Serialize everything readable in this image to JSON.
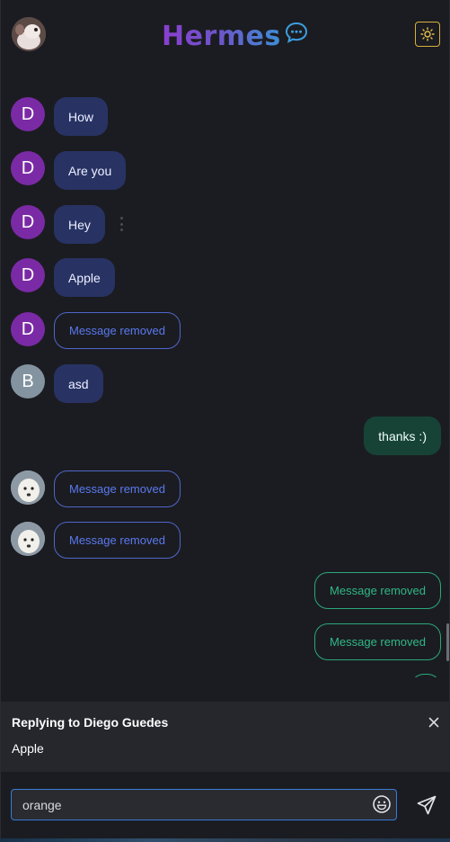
{
  "header": {
    "brand": "Hermes",
    "brand_icon": "chat-bubble-icon",
    "theme_icon": "sun-icon",
    "colors": {
      "brand_start": "#8a3ecf",
      "brand_end": "#3d8fd6",
      "theme_border": "#d8b03c"
    }
  },
  "messages": [
    {
      "side": "in",
      "avatar": "D",
      "text": "How"
    },
    {
      "side": "in",
      "avatar": "D",
      "text": "Are you"
    },
    {
      "side": "in",
      "avatar": "D",
      "text": "Hey"
    },
    {
      "side": "in",
      "avatar": "D",
      "text": "Apple"
    },
    {
      "side": "in",
      "avatar": "D",
      "text": "Message removed",
      "removed": true
    },
    {
      "side": "in",
      "avatar": "B",
      "text": "asd"
    },
    {
      "side": "out",
      "text": "thanks :)"
    },
    {
      "side": "in",
      "avatar": "dog-photo",
      "text": "Message removed",
      "removed": true
    },
    {
      "side": "in",
      "avatar": "dog-photo",
      "text": "Message removed",
      "removed": true
    },
    {
      "side": "out",
      "text": "Message removed",
      "removed": true
    },
    {
      "side": "out",
      "text": "Message removed",
      "removed": true
    }
  ],
  "reply": {
    "title": "Replying to Diego Guedes",
    "text": "Apple",
    "close_icon": "close-icon"
  },
  "composer": {
    "value": "orange",
    "emoji_icon": "emoji-icon",
    "send_icon": "send-icon"
  },
  "colors": {
    "background": "#1b1c21",
    "incoming_bubble": "#283364",
    "outgoing_bubble": "#174337",
    "removed_in": "#5a79ee",
    "removed_out": "#2fb885",
    "avatar_d": "#7b2aa5",
    "avatar_b": "#8393a0"
  }
}
